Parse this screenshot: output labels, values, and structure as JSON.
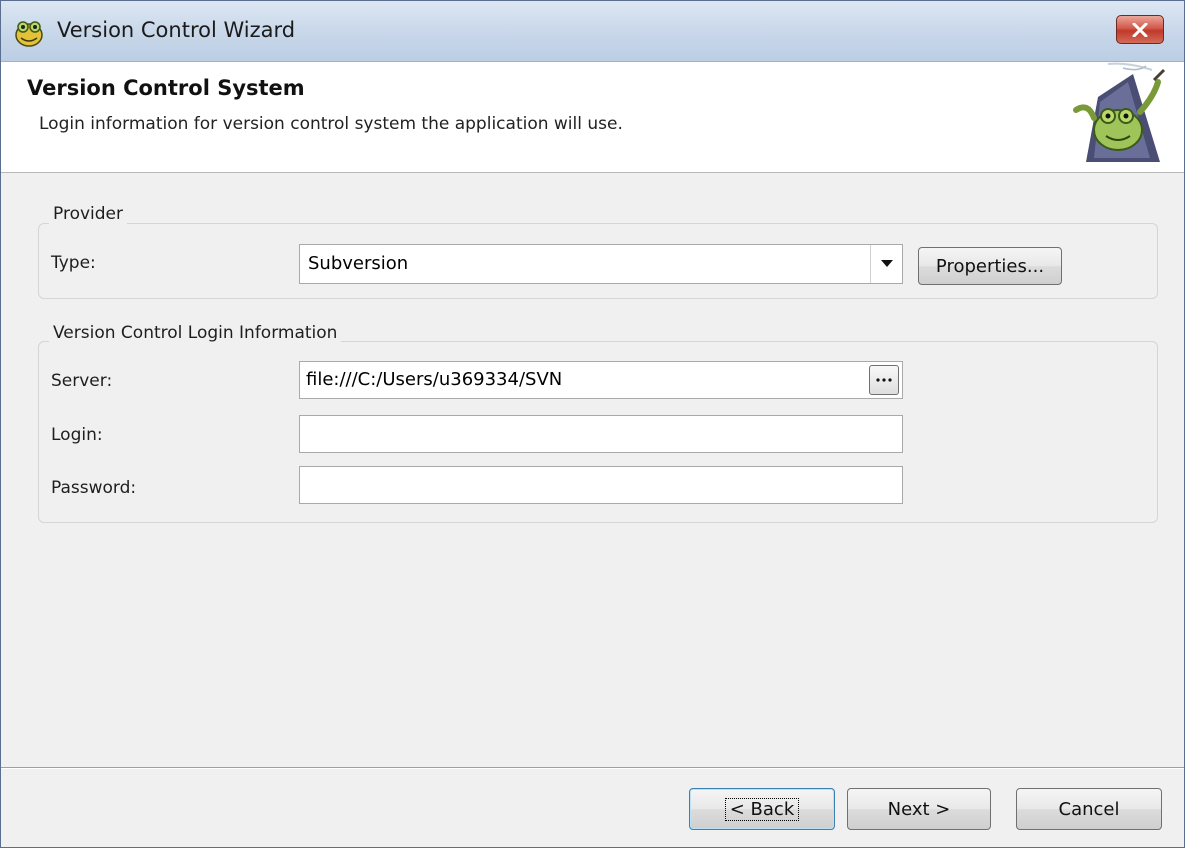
{
  "window": {
    "title": "Version Control Wizard",
    "accent": "#c0392b"
  },
  "header": {
    "title": "Version Control System",
    "subtitle": "Login information for version control system the application will use."
  },
  "provider": {
    "group_label": "Provider",
    "type_label": "Type:",
    "type_value": "Subversion",
    "properties_button": "Properties..."
  },
  "login": {
    "group_label": "Version Control Login Information",
    "server_label": "Server:",
    "server_value": "file:///C:/Users/u369334/SVN",
    "login_label": "Login:",
    "login_value": "",
    "password_label": "Password:",
    "password_value": ""
  },
  "footer": {
    "back_button": "< Back",
    "next_button": "Next >",
    "cancel_button": "Cancel"
  },
  "icons": {
    "app": "toad-icon",
    "close": "close-icon",
    "dropdown": "chevron-down-icon",
    "browse": "ellipsis-icon",
    "wizard_art": "wizard-toad-image"
  }
}
